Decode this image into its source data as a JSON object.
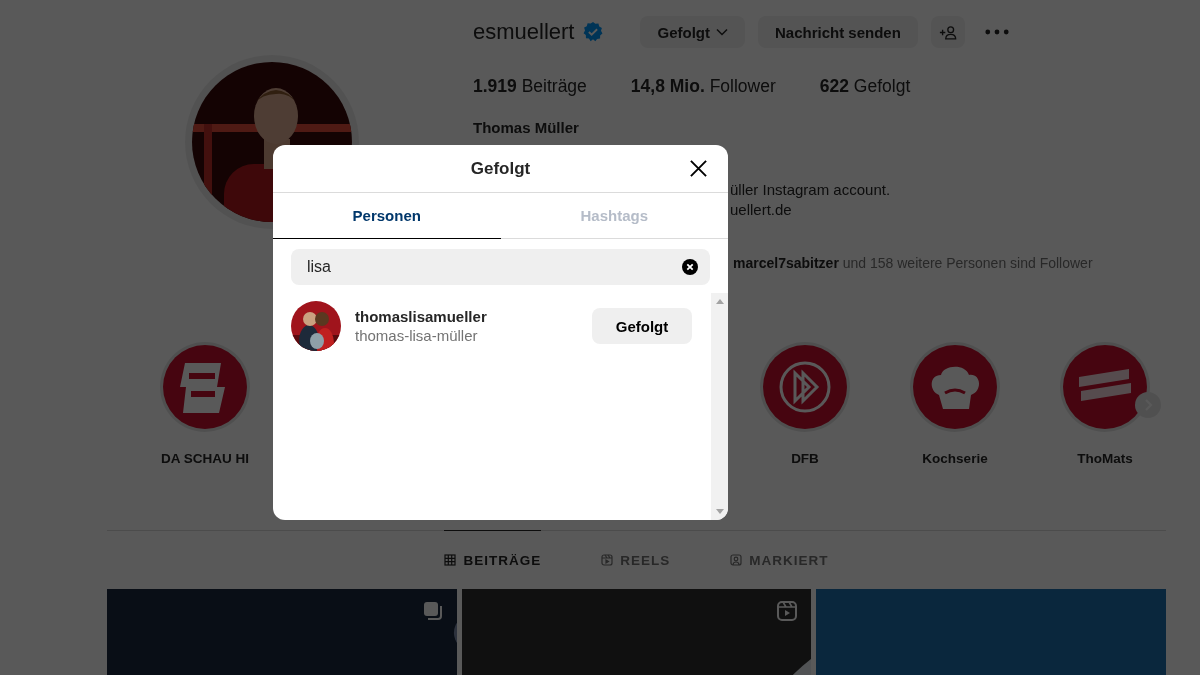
{
  "profile": {
    "username": "esmuellert",
    "verified": true,
    "actions": [
      {
        "kind": "dropdown",
        "label": "Gefolgt"
      },
      {
        "kind": "text",
        "label": "Nachricht senden"
      },
      {
        "kind": "add-person"
      },
      {
        "kind": "more"
      }
    ],
    "stats": [
      {
        "value": "1.919",
        "label": "Beiträge"
      },
      {
        "value": "14,8 Mio.",
        "label": "Follower"
      },
      {
        "value": "622",
        "label": "Gefolgt"
      }
    ],
    "name": "Thomas Müller",
    "bio_lines": [
      "üller Instagram account.",
      "uellert.de"
    ],
    "followed_by": "**marcel7sabitzer** und 158 weitere Personen sind Follower"
  },
  "highlights": [
    {
      "label": "DA SCHAU HI",
      "kind": "sign"
    },
    {
      "label": "DFB",
      "kind": "emblem"
    },
    {
      "label": "Kochserie",
      "kind": "chef-hat"
    },
    {
      "label": "ThoMats",
      "kind": "banner"
    }
  ],
  "post_tabs": [
    {
      "label": "BEITRÄGE",
      "kind": "grid",
      "selected": true
    },
    {
      "label": "REELS",
      "kind": "reel",
      "selected": false
    },
    {
      "label": "MARKIERT",
      "kind": "tag",
      "selected": false
    }
  ],
  "posts": [
    {
      "kind": "carousel"
    },
    {
      "kind": "reel"
    },
    {
      "kind": "plain"
    }
  ],
  "dialog": {
    "title": "Gefolgt",
    "tabs": [
      {
        "label": "Personen",
        "selected": true
      },
      {
        "label": "Hashtags",
        "selected": false
      }
    ],
    "search": {
      "value": "lisa"
    },
    "results": [
      {
        "username": "thomaslisamueller",
        "full_name": "thomas-lisa-müller",
        "button": "Gefolgt"
      }
    ]
  }
}
